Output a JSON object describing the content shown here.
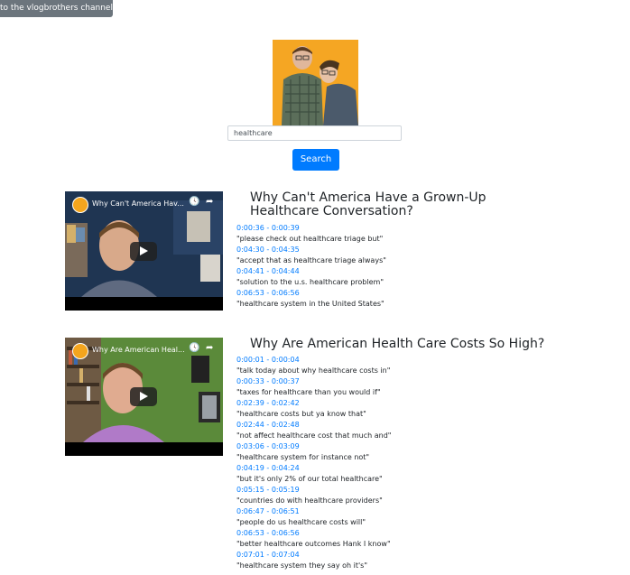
{
  "top_button": {
    "label": "to the vlogbrothers channel"
  },
  "search": {
    "value": "healthcare",
    "button_label": "Search"
  },
  "results": [
    {
      "video_overlay_title": "Why Can't America Hav...",
      "title": "Why Can't America Have a Grown-Up Healthcare Conversation?",
      "matches": [
        {
          "time": "0:00:36 - 0:00:39",
          "quote": "\"please check out healthcare triage but\""
        },
        {
          "time": "0:04:30 - 0:04:35",
          "quote": "\"accept that as healthcare triage always\""
        },
        {
          "time": "0:04:41 - 0:04:44",
          "quote": "\"solution to the u.s. healthcare problem\""
        },
        {
          "time": "0:06:53 - 0:06:56",
          "quote": "\"healthcare system in the United States\""
        }
      ]
    },
    {
      "video_overlay_title": "Why Are American Heal...",
      "title": "Why Are American Health Care Costs So High?",
      "matches": [
        {
          "time": "0:00:01 - 0:00:04",
          "quote": "\"talk today about why healthcare costs in\""
        },
        {
          "time": "0:00:33 - 0:00:37",
          "quote": "\"taxes for healthcare than you would if\""
        },
        {
          "time": "0:02:39 - 0:02:42",
          "quote": "\"healthcare costs but ya know that\""
        },
        {
          "time": "0:02:44 - 0:02:48",
          "quote": "\"not affect healthcare cost that much and\""
        },
        {
          "time": "0:03:06 - 0:03:09",
          "quote": "\"healthcare system for instance not\""
        },
        {
          "time": "0:04:19 - 0:04:24",
          "quote": "\"but it's only 2% of our total healthcare\""
        },
        {
          "time": "0:05:15 - 0:05:19",
          "quote": "\"countries do with healthcare providers\""
        },
        {
          "time": "0:06:47 - 0:06:51",
          "quote": "\"people do us healthcare costs will\""
        },
        {
          "time": "0:06:53 - 0:06:56",
          "quote": "\"better healthcare outcomes Hank I know\""
        },
        {
          "time": "0:07:01 - 0:07:04",
          "quote": "\"healthcare system they say oh it's\""
        }
      ]
    }
  ]
}
